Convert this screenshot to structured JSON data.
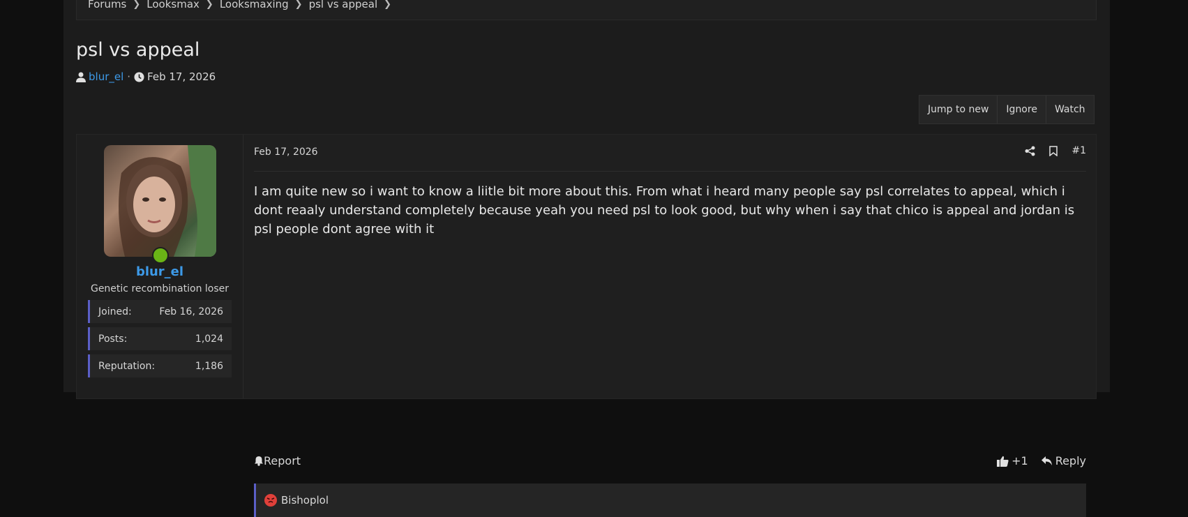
{
  "breadcrumb": {
    "items": [
      "Forums",
      "Looksmax",
      "Looksmaxing",
      "psl vs appeal"
    ]
  },
  "thread": {
    "title": "psl vs appeal",
    "author": "blur_el",
    "separator": "·",
    "date": "Feb 17, 2026"
  },
  "actions": {
    "jump": "Jump to new",
    "ignore": "Ignore",
    "watch": "Watch"
  },
  "user": {
    "name": "blur_el",
    "user_title": "Genetic recombination loser",
    "stats": [
      {
        "label": "Joined:",
        "value": "Feb 16, 2026"
      },
      {
        "label": "Posts:",
        "value": "1,024"
      },
      {
        "label": "Reputation:",
        "value": "1,186"
      }
    ]
  },
  "post": {
    "date": "Feb 17, 2026",
    "number": "#1",
    "body": "I am quite new so i want to know a liitle bit more about this. From what i heard many people say psl correlates to appeal, which i dont reaaly understand completely because yeah you need psl to look good, but why when i say that chico is appeal and jordan is psl people dont agree with it",
    "report": "Report",
    "like_count": "+1",
    "reply": "Reply",
    "reaction_user": "Bishoplol"
  },
  "colors": {
    "link": "#3d9ae8",
    "accent": "#5b5fc7",
    "online": "#6ab416"
  }
}
